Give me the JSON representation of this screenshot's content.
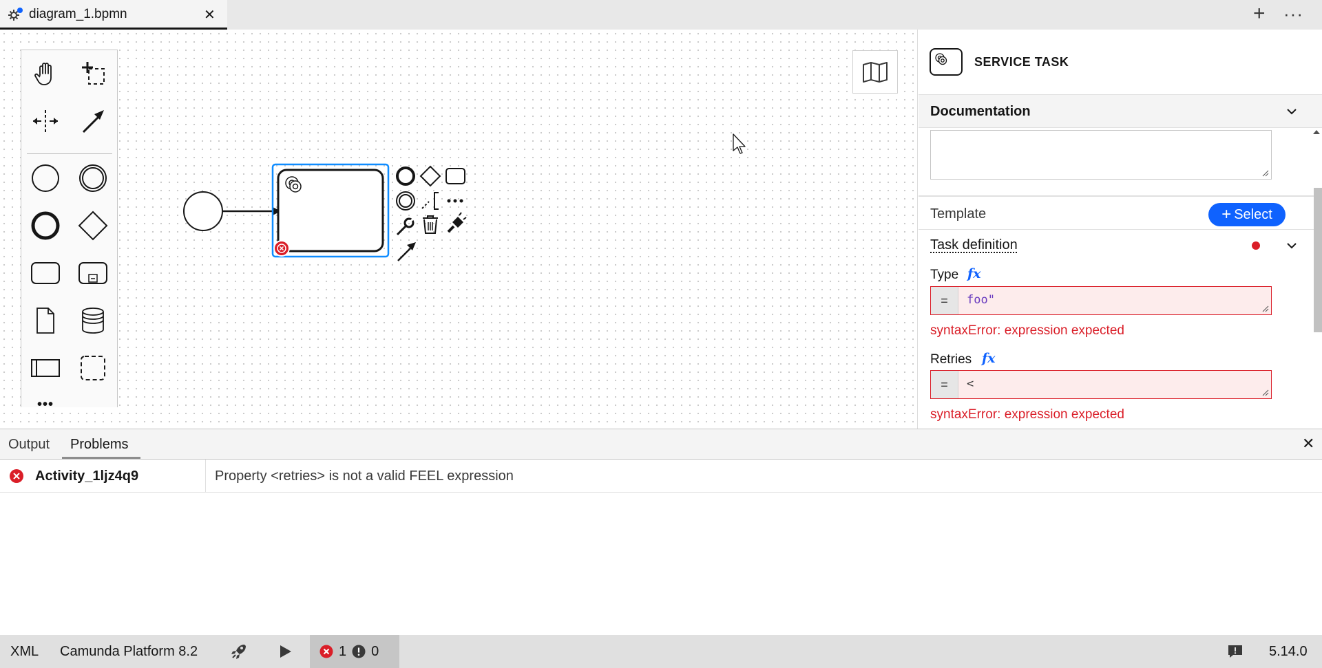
{
  "tab": {
    "title": "diagram_1.bpmn",
    "close": "✕"
  },
  "tabbar": {
    "add": "+",
    "more": "···"
  },
  "palette": {
    "tools": [
      "hand-tool",
      "lasso-tool",
      "space-tool",
      "global-connect-tool"
    ],
    "shapes": [
      "start-event",
      "intermediate-event",
      "end-event",
      "gateway",
      "task",
      "subprocess",
      "data-object",
      "data-store",
      "pool",
      "group"
    ],
    "more": "•••"
  },
  "properties": {
    "header_title": "SERVICE TASK",
    "documentation_label": "Documentation",
    "documentation_value": "",
    "template_label": "Template",
    "select_button": "Select",
    "task_definition_label": "Task definition",
    "type_label": "Type",
    "type_value": "foo\"",
    "type_error": "syntaxError: expression expected",
    "retries_label": "Retries",
    "retries_value": "<",
    "retries_error": "syntaxError: expression expected",
    "fx": "fx",
    "eq": "="
  },
  "bottom_panel": {
    "tabs": [
      "Output",
      "Problems"
    ],
    "active_tab": "Problems",
    "close": "✕",
    "problems": [
      {
        "id": "Activity_1ljz4q9",
        "message": "Property <retries> is not a valid FEEL expression"
      }
    ]
  },
  "statusbar": {
    "xml": "XML",
    "platform": "Camunda Platform 8.2",
    "errors": "1",
    "warnings": "0",
    "version": "5.14.0"
  },
  "colors": {
    "accent": "#0f62fe",
    "error": "#da1e28",
    "selection": "#0f8cff"
  }
}
